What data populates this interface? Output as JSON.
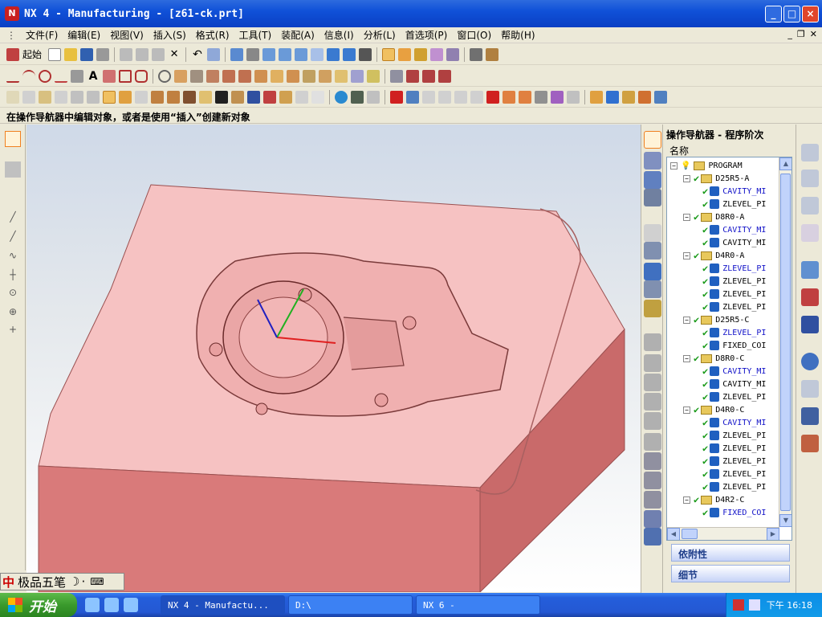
{
  "window": {
    "title": "NX 4 - Manufacturing - [z61-ck.prt]",
    "app_icon": "nx-logo-icon"
  },
  "menu": [
    "文件(F)",
    "编辑(E)",
    "视图(V)",
    "插入(S)",
    "格式(R)",
    "工具(T)",
    "装配(A)",
    "信息(I)",
    "分析(L)",
    "首选项(P)",
    "窗口(O)",
    "帮助(H)"
  ],
  "toolbar": {
    "start_label": "起始"
  },
  "status": {
    "prompt": "在操作导航器中编辑对象，或者是使用“插入”创建新对象"
  },
  "navigator": {
    "title": "操作导航器 - 程序阶次",
    "column_header": "名称",
    "tree": [
      {
        "depth": 0,
        "label": "PROGRAM",
        "kind": "root"
      },
      {
        "depth": 1,
        "label": "D25R5-A",
        "kind": "group"
      },
      {
        "depth": 2,
        "label": "CAVITY_MI",
        "kind": "op",
        "blue": true
      },
      {
        "depth": 2,
        "label": "ZLEVEL_PI",
        "kind": "op",
        "blue": false
      },
      {
        "depth": 1,
        "label": "D8R0-A",
        "kind": "group"
      },
      {
        "depth": 2,
        "label": "CAVITY_MI",
        "kind": "op",
        "blue": true
      },
      {
        "depth": 2,
        "label": "CAVITY_MI",
        "kind": "op",
        "blue": false
      },
      {
        "depth": 1,
        "label": "D4R0-A",
        "kind": "group"
      },
      {
        "depth": 2,
        "label": "ZLEVEL_PI",
        "kind": "op",
        "blue": true
      },
      {
        "depth": 2,
        "label": "ZLEVEL_PI",
        "kind": "op",
        "blue": false
      },
      {
        "depth": 2,
        "label": "ZLEVEL_PI",
        "kind": "op",
        "blue": false
      },
      {
        "depth": 2,
        "label": "ZLEVEL_PI",
        "kind": "op",
        "blue": false
      },
      {
        "depth": 1,
        "label": "D25R5-C",
        "kind": "group"
      },
      {
        "depth": 2,
        "label": "ZLEVEL_PI",
        "kind": "op",
        "blue": true
      },
      {
        "depth": 2,
        "label": "FIXED_COI",
        "kind": "op",
        "blue": false
      },
      {
        "depth": 1,
        "label": "D8R0-C",
        "kind": "group"
      },
      {
        "depth": 2,
        "label": "CAVITY_MI",
        "kind": "op",
        "blue": true
      },
      {
        "depth": 2,
        "label": "CAVITY_MI",
        "kind": "op",
        "blue": false
      },
      {
        "depth": 2,
        "label": "ZLEVEL_PI",
        "kind": "op",
        "blue": false
      },
      {
        "depth": 1,
        "label": "D4R0-C",
        "kind": "group"
      },
      {
        "depth": 2,
        "label": "CAVITY_MI",
        "kind": "op",
        "blue": true
      },
      {
        "depth": 2,
        "label": "ZLEVEL_PI",
        "kind": "op",
        "blue": false
      },
      {
        "depth": 2,
        "label": "ZLEVEL_PI",
        "kind": "op",
        "blue": false
      },
      {
        "depth": 2,
        "label": "ZLEVEL_PI",
        "kind": "op",
        "blue": false
      },
      {
        "depth": 2,
        "label": "ZLEVEL_PI",
        "kind": "op",
        "blue": false
      },
      {
        "depth": 2,
        "label": "ZLEVEL_PI",
        "kind": "op",
        "blue": false
      },
      {
        "depth": 1,
        "label": "D4R2-C",
        "kind": "group"
      },
      {
        "depth": 2,
        "label": "FIXED_COI",
        "kind": "op",
        "blue": true
      }
    ],
    "section_dependency": "依附性",
    "section_details": "细节"
  },
  "ime": {
    "name": "极品五笔"
  },
  "taskbar": {
    "start_label": "开始",
    "tasks": [
      "NX 4 - Manufactu...",
      "D:\\",
      "NX 6 -"
    ],
    "clock": "下午 16:18"
  },
  "colors": {
    "part_face": "#f4b8b8",
    "part_side": "#d97a7a",
    "titlebar": "#0a3fc4",
    "check": "#1a9a1a"
  }
}
